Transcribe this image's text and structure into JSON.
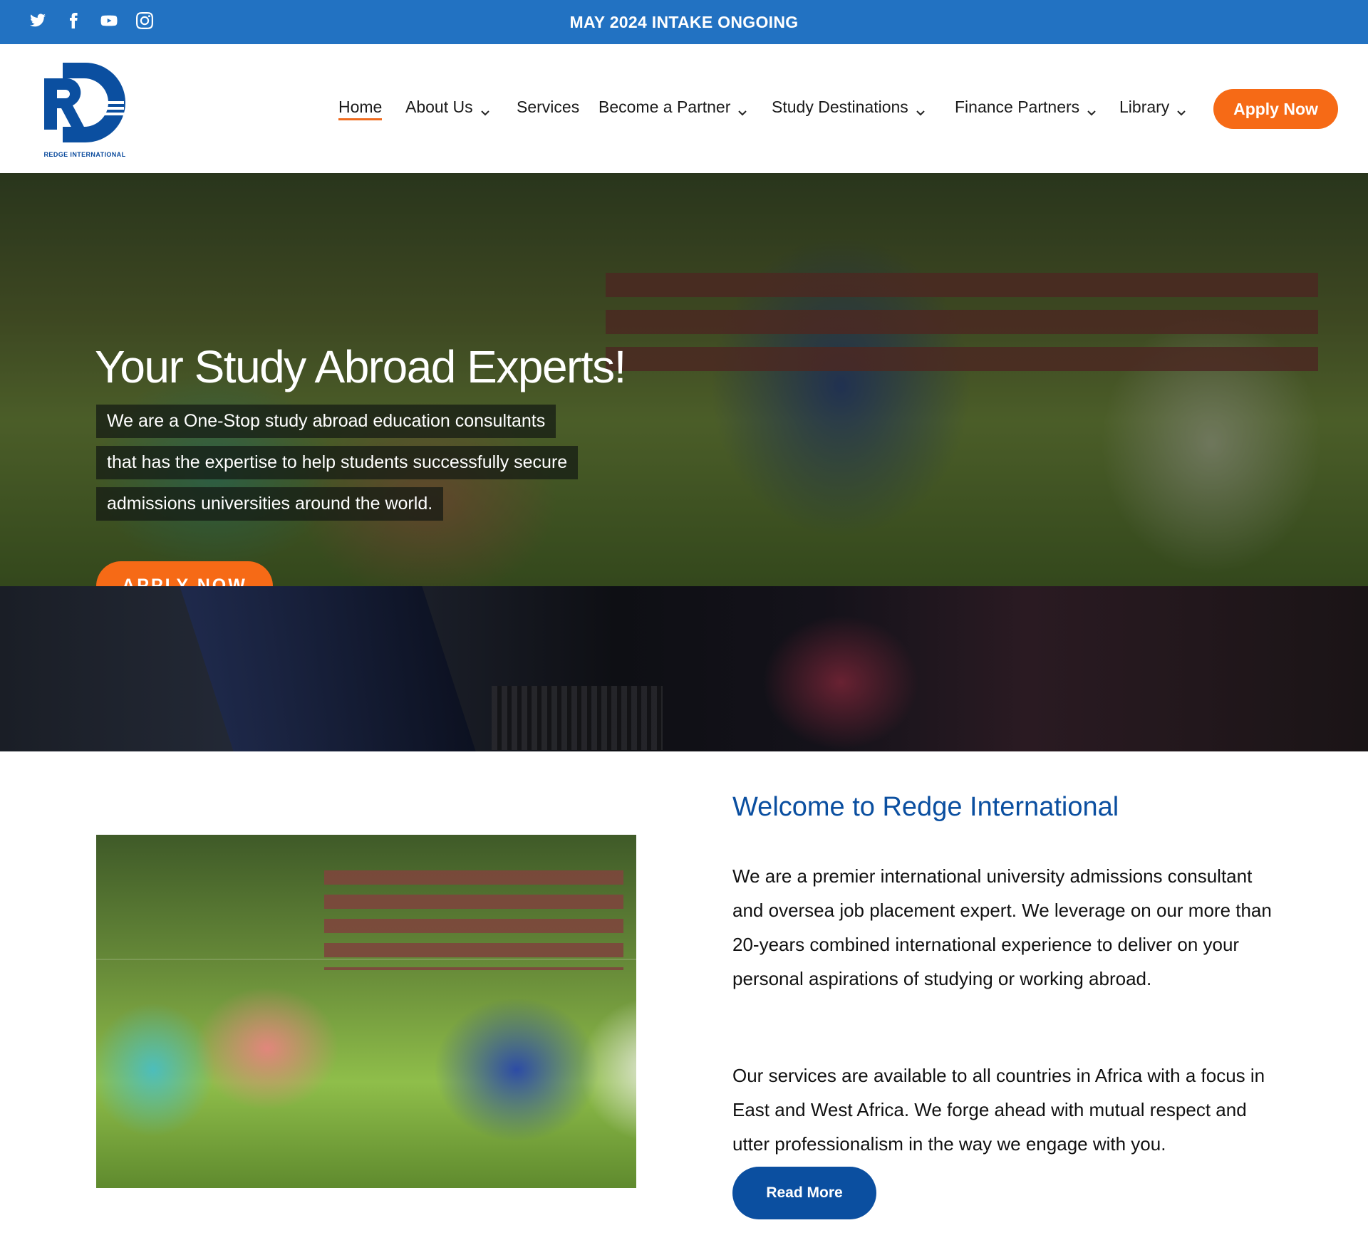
{
  "topbar": {
    "announcement": "MAY 2024 INTAKE ONGOING",
    "social": [
      "twitter-icon",
      "facebook-icon",
      "youtube-icon",
      "instagram-icon"
    ],
    "bg_color": "#2272c2"
  },
  "header": {
    "logo_text": "REDGE INTERNATIONAL",
    "nav": [
      {
        "label": "Home",
        "active": true,
        "dropdown": false
      },
      {
        "label": "About Us",
        "dropdown": true
      },
      {
        "label": "Services",
        "dropdown": false
      },
      {
        "label": "Become a Partner",
        "dropdown": true
      },
      {
        "label": "Study Destinations",
        "dropdown": true
      },
      {
        "label": "Finance Partners",
        "dropdown": true
      },
      {
        "label": "Library",
        "dropdown": true
      }
    ],
    "apply_label": "Apply Now",
    "accent_color": "#f66a16"
  },
  "hero": {
    "title": "Your Study Abroad Experts!",
    "lines": [
      "We are a One-Stop study abroad education consultants",
      "that has the expertise to help students successfully secure",
      "admissions universities around the world."
    ],
    "button_label": "APPLY NOW"
  },
  "welcome": {
    "title": "Welcome to Redge International",
    "paragraph1": "We are a premier international university admissions consultant and oversea job placement expert. We leverage on our more than 20-years combined international experience to deliver on your personal aspirations of studying or working abroad.",
    "paragraph2": "Our services are available to all countries in Africa with a focus in East and West Africa. We forge ahead with mutual respect and utter professionalism in the way we engage with you.",
    "button_label": "Read More",
    "brand_color": "#0b4fa0"
  }
}
